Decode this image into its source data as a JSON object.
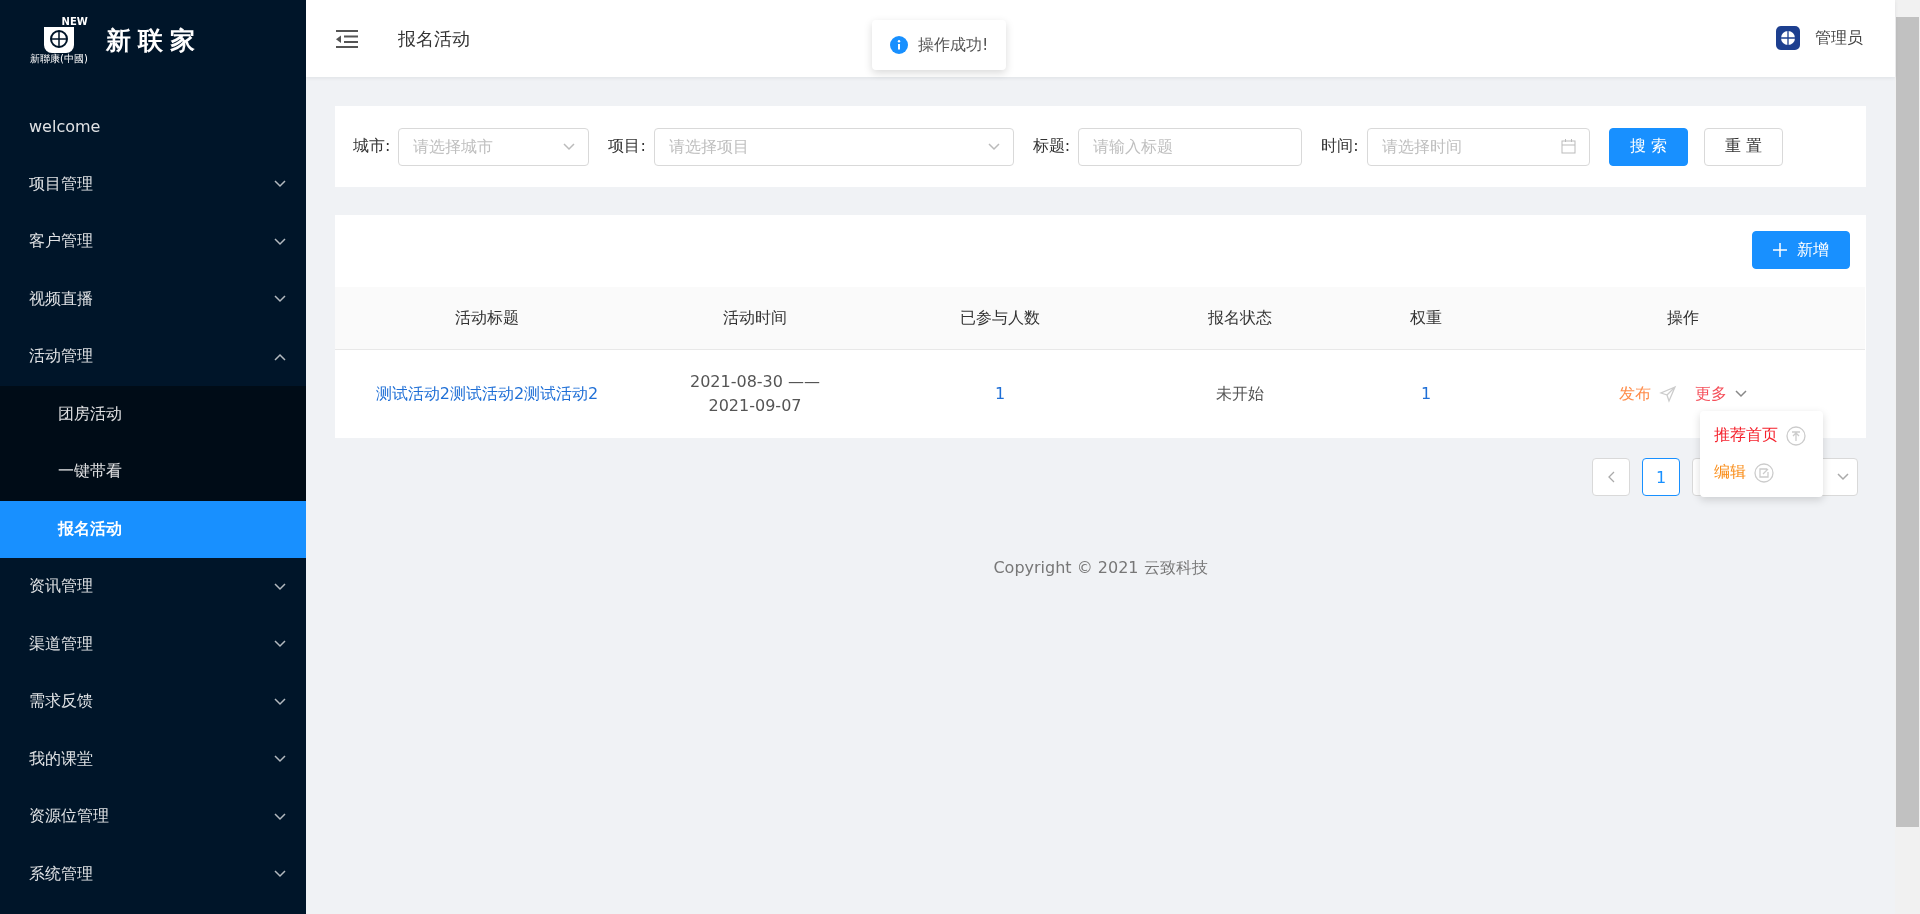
{
  "logo": {
    "badge": "NEW",
    "caption": "新聯康(中國)",
    "brand": "新联家"
  },
  "sidebar": {
    "items": [
      {
        "label": "welcome",
        "kind": "link",
        "selected": false
      },
      {
        "label": "项目管理",
        "kind": "menu",
        "expanded": false
      },
      {
        "label": "客户管理",
        "kind": "menu",
        "expanded": false
      },
      {
        "label": "视频直播",
        "kind": "menu",
        "expanded": false
      },
      {
        "label": "活动管理",
        "kind": "menu",
        "expanded": true,
        "children": [
          {
            "label": "团房活动",
            "selected": false
          },
          {
            "label": "一键带看",
            "selected": false
          },
          {
            "label": "报名活动",
            "selected": true
          }
        ]
      },
      {
        "label": "资讯管理",
        "kind": "menu",
        "expanded": false
      },
      {
        "label": "渠道管理",
        "kind": "menu",
        "expanded": false
      },
      {
        "label": "需求反馈",
        "kind": "menu",
        "expanded": false
      },
      {
        "label": "我的课堂",
        "kind": "menu",
        "expanded": false
      },
      {
        "label": "资源位管理",
        "kind": "menu",
        "expanded": false
      },
      {
        "label": "系统管理",
        "kind": "menu",
        "expanded": false
      }
    ]
  },
  "header": {
    "title": "报名活动",
    "user": "管理员"
  },
  "toast": {
    "message": "操作成功!"
  },
  "filters": [
    {
      "label": "城市:",
      "placeholder": "请选择城市",
      "kind": "select"
    },
    {
      "label": "项目:",
      "placeholder": "请选择项目",
      "kind": "select"
    },
    {
      "label": "标题:",
      "placeholder": "请输入标题",
      "kind": "input"
    },
    {
      "label": "时间:",
      "placeholder": "请选择时间",
      "kind": "date"
    }
  ],
  "search_button": "搜 索",
  "reset_button": "重 置",
  "add_button": "新增",
  "table": {
    "columns": [
      "活动标题",
      "活动时间",
      "已参与人数",
      "报名状态",
      "权重",
      "操作"
    ],
    "rows": [
      {
        "title": "测试活动2测试活动2测试活动2",
        "time": "2021-08-30 —— 2021-09-07",
        "joined": "1",
        "status": "未开始",
        "weight": "1",
        "publish": "发布",
        "more": "更多"
      }
    ]
  },
  "more_menu": [
    {
      "label": "推荐首页",
      "kind": "top",
      "color": "#f5222d"
    },
    {
      "label": "编辑",
      "kind": "edit",
      "color": "#fa8c16"
    }
  ],
  "pagination": {
    "pages": [
      {
        "label": "1",
        "selected": true
      }
    ]
  },
  "footer": "Copyright © 2021 云致科技"
}
